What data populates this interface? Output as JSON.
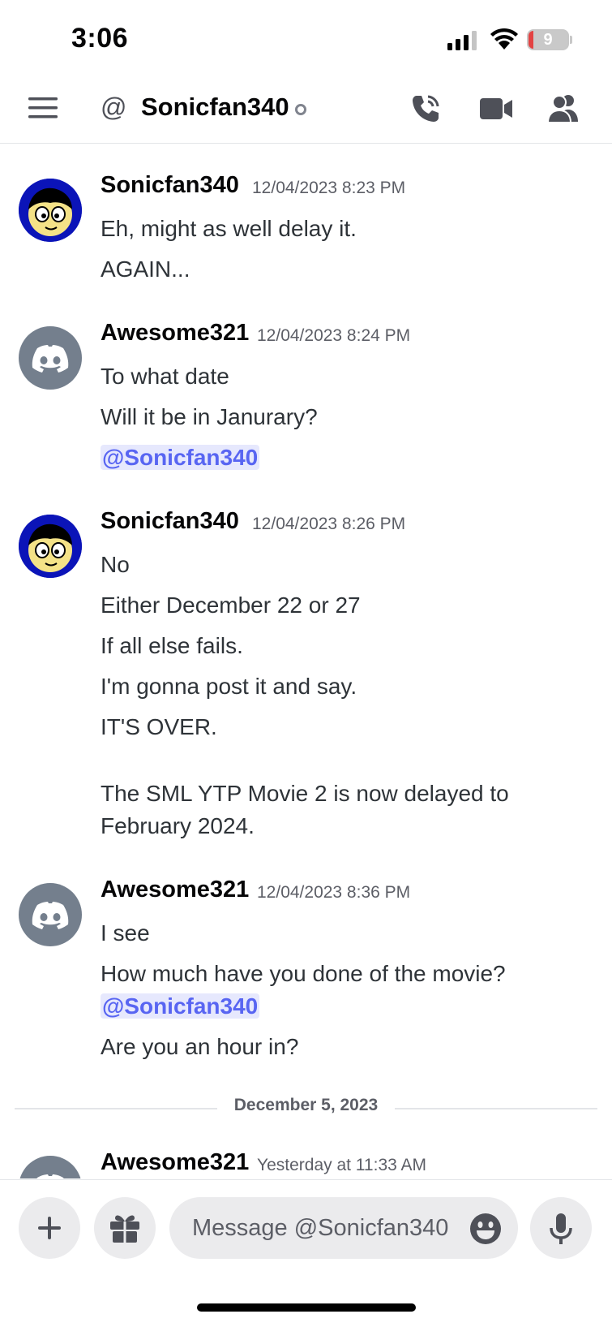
{
  "status_bar": {
    "time": "3:06",
    "battery": "9"
  },
  "header": {
    "at_symbol": "@",
    "title": "Sonicfan340"
  },
  "messages": [
    {
      "author": "Sonicfan340",
      "timestamp": "12/04/2023 8:23 PM",
      "lines": [
        "Eh, might as well delay it.",
        "AGAIN..."
      ]
    },
    {
      "author": "Awesome321",
      "timestamp": "12/04/2023 8:24 PM",
      "lines": [
        "To what date",
        "Will it be in Janurary?"
      ],
      "mention": "@Sonicfan340"
    },
    {
      "author": "Sonicfan340",
      "timestamp": "12/04/2023 8:26 PM",
      "lines": [
        "No",
        "Either December 22 or 27",
        "If all else fails.",
        "I'm gonna post it and say.",
        "IT'S OVER.",
        "The SML YTP Movie 2 is now delayed to",
        "February 2024."
      ]
    },
    {
      "author": "Awesome321",
      "timestamp": "12/04/2023 8:36 PM",
      "lines": [
        "I see",
        "How much have you done of the movie?",
        "Are you an hour in?"
      ],
      "mention": "@Sonicfan340"
    },
    {
      "author": "Awesome321",
      "timestamp": "Yesterday at 11:33 AM"
    }
  ],
  "date_divider": "December 5, 2023",
  "composer": {
    "placeholder": "Message @Sonicfan340"
  },
  "colors": {
    "blurple": "#5865f2",
    "mention_bg": "#e6e8fd",
    "discord_avatar": "#747f8d",
    "battery_low": "#e34343"
  },
  "icons": [
    "menu-icon",
    "at-icon",
    "phone-call-icon",
    "video-camera-icon",
    "members-icon",
    "plus-icon",
    "gift-icon",
    "emoji-icon",
    "microphone-icon",
    "discord-logo-icon"
  ]
}
